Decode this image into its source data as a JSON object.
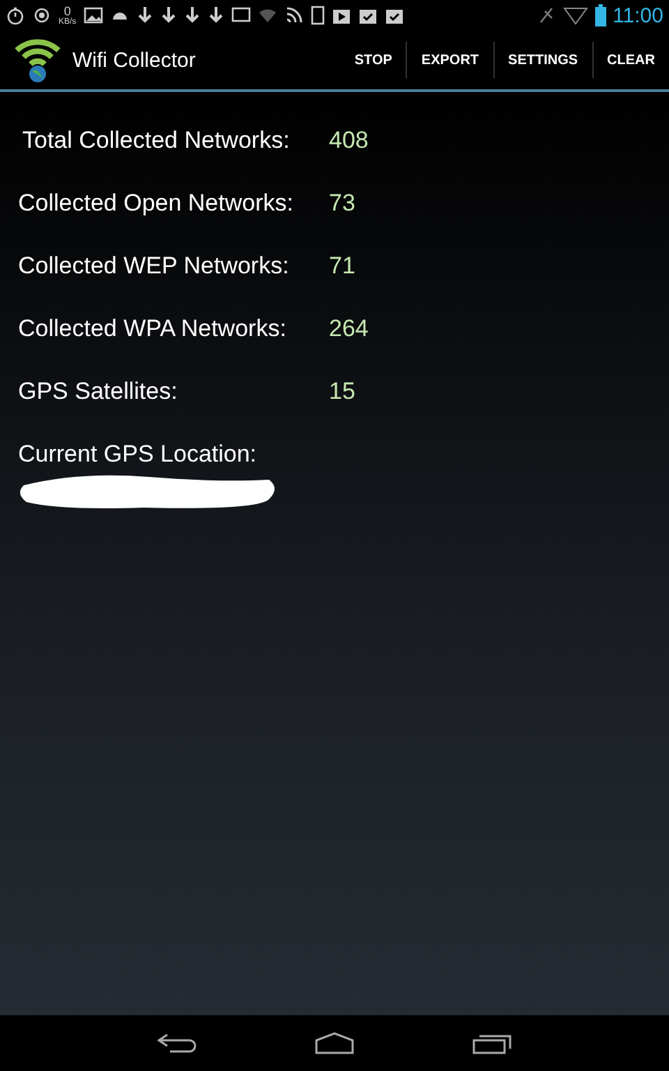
{
  "status_bar": {
    "speed_value": "0",
    "speed_unit": "KB/s",
    "time": "11:00"
  },
  "action_bar": {
    "title": "Wifi Collector",
    "actions": [
      "STOP",
      "EXPORT",
      "SETTINGS",
      "CLEAR"
    ]
  },
  "stats": [
    {
      "label": "Total Collected Networks:",
      "value": "408"
    },
    {
      "label": "Collected Open Networks:",
      "value": "73"
    },
    {
      "label": "Collected WEP Networks:",
      "value": "71"
    },
    {
      "label": "Collected WPA Networks:",
      "value": "264"
    },
    {
      "label": "GPS Satellites:",
      "value": "15"
    }
  ],
  "location": {
    "label": "Current GPS Location:",
    "redacted": true
  }
}
